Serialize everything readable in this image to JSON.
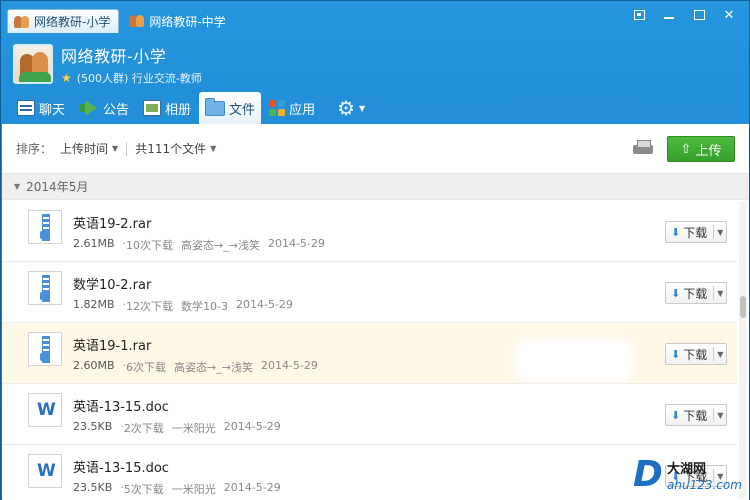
{
  "window": {
    "tabs": [
      {
        "label": "网络教研-小学",
        "active": true
      },
      {
        "label": "网络教研-中学",
        "active": false
      }
    ],
    "controls": [
      "restore",
      "minimize",
      "maximize",
      "close"
    ],
    "close_glyph": "✕"
  },
  "group": {
    "name": "网络教研-小学",
    "info": "(500人群) 行业交流-教师"
  },
  "nav": {
    "items": [
      {
        "label": "聊天",
        "icon": "chat-icon"
      },
      {
        "label": "公告",
        "icon": "bullhorn-icon"
      },
      {
        "label": "相册",
        "icon": "album-icon"
      },
      {
        "label": "文件",
        "icon": "folder-icon",
        "active": true
      },
      {
        "label": "应用",
        "icon": "apps-icon"
      }
    ],
    "settings_icon": "gear-icon"
  },
  "toolbar": {
    "sort_label": "排序：",
    "sort_value": "上传时间",
    "count_value": "共111个文件",
    "upload_label": "上传"
  },
  "files": {
    "group_label": "2014年5月",
    "download_label": "下载",
    "items": [
      {
        "name": "英语19-2.rar",
        "size": "2.61MB",
        "downloads": "10次下载",
        "uploader": "高姿态→_→浅笑",
        "date": "2014-5-29",
        "type": "zip"
      },
      {
        "name": "数学10-2.rar",
        "size": "1.82MB",
        "downloads": "12次下载",
        "uploader": "数学10-3",
        "date": "2014-5-29",
        "type": "zip"
      },
      {
        "name": "英语19-1.rar",
        "size": "2.60MB",
        "downloads": "6次下载",
        "uploader": "高姿态→_→浅笑",
        "date": "2014-5-29",
        "type": "zip"
      },
      {
        "name": "英语-13-15.doc",
        "size": "23.5KB",
        "downloads": "2次下载",
        "uploader": "一米阳光",
        "date": "2014-5-29",
        "type": "doc"
      },
      {
        "name": "英语-13-15.doc",
        "size": "23.5KB",
        "downloads": "5次下载",
        "uploader": "一米阳光",
        "date": "2014-5-29",
        "type": "doc"
      }
    ]
  },
  "watermark": {
    "letter": "D",
    "cn": "大湖网",
    "url": "ahu123.com"
  },
  "colors": {
    "titlebar": "#1b82cc",
    "upload_button": "#3fae33",
    "highlight_row": "#fff8e6",
    "apps_icon": [
      "#e8541f",
      "#3a9bd9",
      "#52b44f",
      "#f0b429"
    ]
  }
}
